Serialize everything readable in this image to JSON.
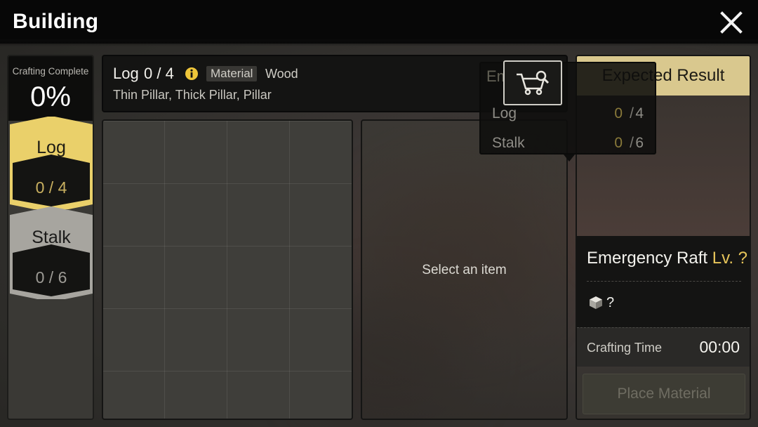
{
  "header": {
    "title": "Building"
  },
  "progress": {
    "label": "Crafting Complete",
    "value": "0%"
  },
  "materials": [
    {
      "name": "Log",
      "count": "0 / 4",
      "selected": true
    },
    {
      "name": "Stalk",
      "count": "0 / 6",
      "selected": false
    }
  ],
  "selected_material": {
    "name": "Log",
    "count": "0 / 4",
    "tag": "Material",
    "type": "Wood",
    "used_for": "Thin Pillar, Thick Pillar, Pillar"
  },
  "select_panel": {
    "placeholder": "Select an item"
  },
  "tooltip": {
    "header_partial": "Emergen",
    "rows": [
      {
        "name": "Log",
        "have": "0",
        "need": "4"
      },
      {
        "name": "Stalk",
        "have": "0",
        "need": "6"
      }
    ]
  },
  "result": {
    "header": "Expected Result",
    "name": "Emergency Raft",
    "level": "Lv. ?",
    "item_count": "?",
    "time_label": "Crafting Time",
    "time_value": "00:00",
    "place_button": "Place Material"
  },
  "colors": {
    "accent_gold": "#e7c55a",
    "selected_card": "#f0d060",
    "header_bg": "#070707",
    "expected_header": "#d9c88e"
  },
  "icons": {
    "close": "close-icon",
    "info": "info-icon",
    "shop": "shopping-cart-search-icon",
    "cube": "cube-icon"
  }
}
